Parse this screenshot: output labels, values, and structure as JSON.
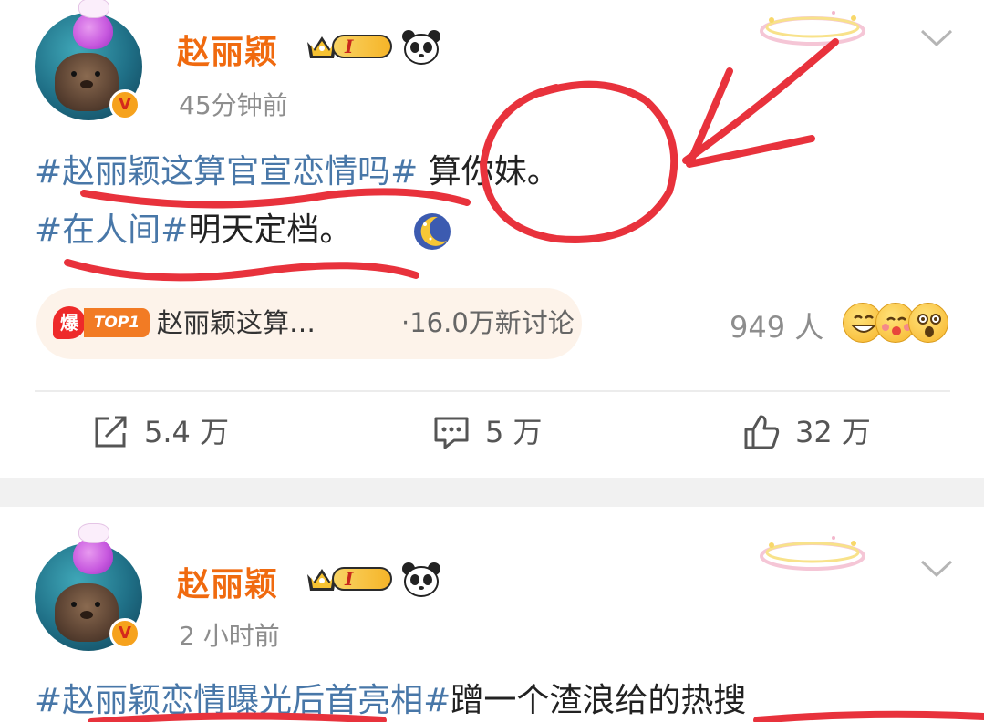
{
  "posts": [
    {
      "username": "赵丽颖",
      "vip_level": "I",
      "timestamp": "45分钟前",
      "lines": [
        [
          {
            "text": "#赵丽颖这算官宣恋情吗#",
            "kind": "topic"
          },
          {
            "text": " 算你妹。",
            "kind": "text"
          }
        ],
        [
          {
            "text": "#在人间#",
            "kind": "topic"
          },
          {
            "text": "明天定档。",
            "kind": "text"
          }
        ]
      ],
      "hot_tag": {
        "badge": "爆",
        "rank": "TOP1",
        "title": "赵丽颖这算…",
        "discussion": "·16.0万新讨论"
      },
      "people": "949 人",
      "actions": {
        "repost": "5.4 万",
        "comment": "5 万",
        "like": "32 万"
      }
    },
    {
      "username": "赵丽颖",
      "vip_level": "I",
      "timestamp": "2 小时前",
      "lines": [
        [
          {
            "text": "#赵丽颖恋情曝光后首亮相#",
            "kind": "topic"
          },
          {
            "text": "蹭一个渣浪给的热搜",
            "kind": "text"
          }
        ]
      ]
    }
  ],
  "icons": {
    "repost": "share-edit-icon",
    "comment": "comment-icon",
    "like": "thumbs-up-icon",
    "menu": "chevron-down-icon",
    "verified": "v-verified-badge-icon",
    "panda": "panda-icon",
    "vip": "crown-vip-badge-icon",
    "moon": "crescent-moon-emoji-icon"
  },
  "colors": {
    "username": "#f06a0f",
    "topic": "#4877a8",
    "annotation": "#e8323c",
    "timestamp": "#8d8d8d"
  }
}
